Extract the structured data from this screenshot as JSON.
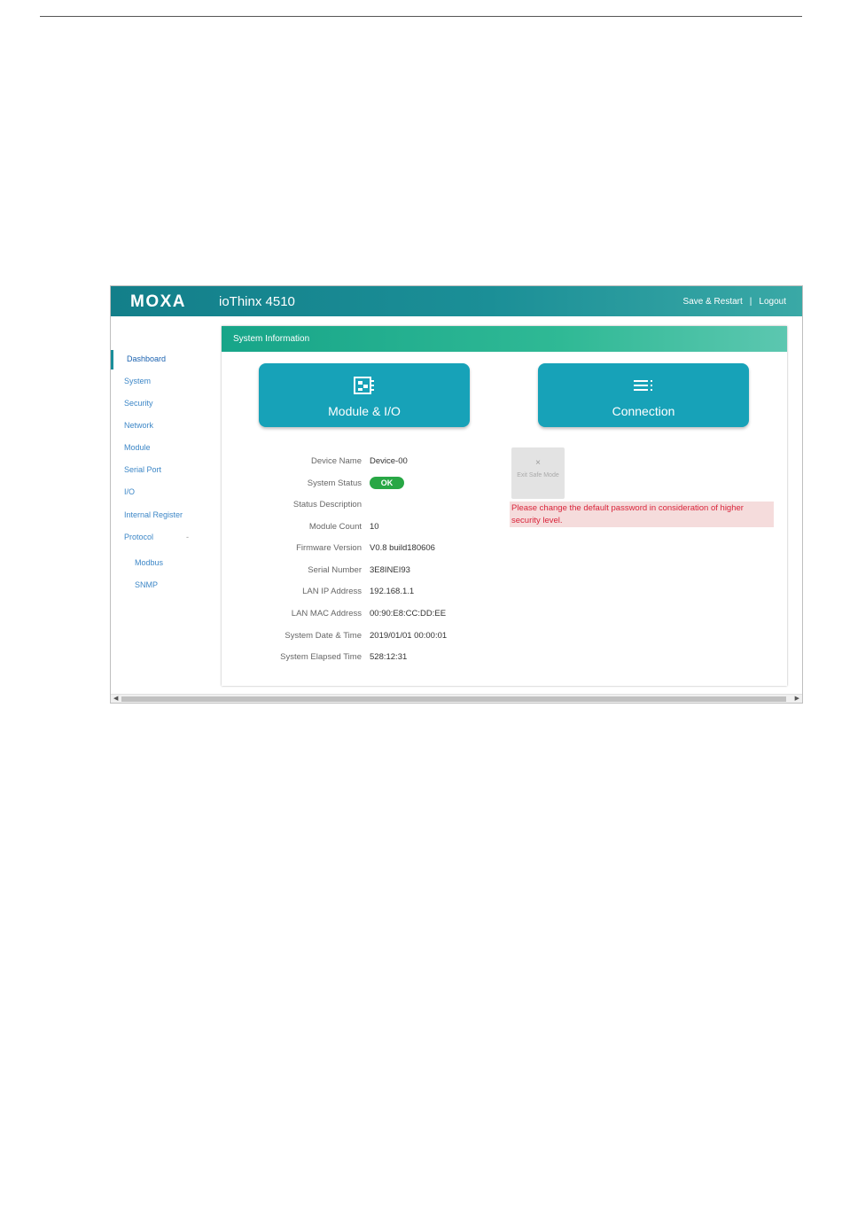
{
  "header": {
    "brand": "MOXA",
    "product": "ioThinx 4510",
    "save_restart": "Save & Restart",
    "separator": "|",
    "logout": "Logout"
  },
  "sidebar": {
    "items": [
      {
        "label": "Dashboard"
      },
      {
        "label": "System"
      },
      {
        "label": "Security"
      },
      {
        "label": "Network"
      },
      {
        "label": "Module"
      },
      {
        "label": "Serial Port"
      },
      {
        "label": "I/O"
      },
      {
        "label": "Internal Register"
      },
      {
        "label": "Protocol"
      },
      {
        "label": "Modbus"
      },
      {
        "label": "SNMP"
      }
    ],
    "protocol_caret": "-"
  },
  "panel": {
    "title": "System Information",
    "module_button": "Module & I/O",
    "connection_button": "Connection"
  },
  "info": {
    "rows": [
      {
        "label": "Device Name",
        "value": "Device-00"
      },
      {
        "label": "System Status",
        "value": "OK"
      },
      {
        "label": "Status Description",
        "value": ""
      },
      {
        "label": "Module Count",
        "value": "10"
      },
      {
        "label": "Firmware Version",
        "value": "V0.8 build180606"
      },
      {
        "label": "Serial Number",
        "value": "3E8INEI93"
      },
      {
        "label": "LAN IP Address",
        "value": "192.168.1.1"
      },
      {
        "label": "LAN MAC Address",
        "value": "00:90:E8:CC:DD:EE"
      },
      {
        "label": "System Date & Time",
        "value": "2019/01/01 00:00:01"
      },
      {
        "label": "System Elapsed Time",
        "value": "528:12:31"
      }
    ]
  },
  "safe_mode": {
    "x": "×",
    "label": "Exit Safe Mode"
  },
  "warning": "Please change the default password in consideration of higher security level.",
  "colors": {
    "header_bar": "#137f8a",
    "section_head": "#17a589",
    "big_button": "#17a2b8",
    "ok_badge": "#28a745",
    "warning_text": "#d9243a",
    "warning_bg": "#f5dcdc",
    "nav_link": "#3d87c7"
  },
  "icons": {
    "module": "module-chip-icon",
    "connection": "connection-list-icon"
  }
}
